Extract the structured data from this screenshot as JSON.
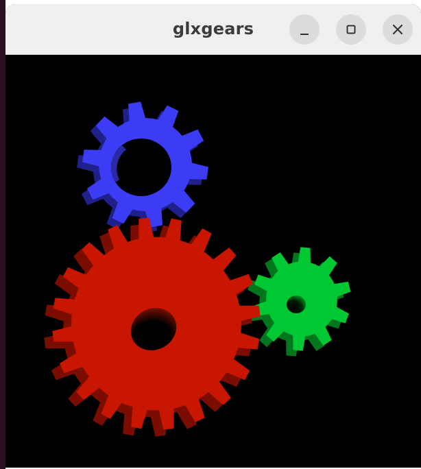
{
  "window": {
    "title": "glxgears"
  },
  "titlebar": {
    "buttons": [
      {
        "name": "minimize",
        "icon": "minimize-icon"
      },
      {
        "name": "maximize",
        "icon": "maximize-icon"
      },
      {
        "name": "close",
        "icon": "close-icon"
      }
    ]
  },
  "scene": {
    "background": "#000000",
    "gears": [
      {
        "name": "red-gear",
        "color": "#c81600",
        "shade": "#7a0d00",
        "teeth": 20
      },
      {
        "name": "green-gear",
        "color": "#00c832",
        "shade": "#00761d",
        "teeth": 10
      },
      {
        "name": "blue-gear",
        "color": "#3c3cf5",
        "shade": "#20208a",
        "teeth": 10
      }
    ]
  }
}
